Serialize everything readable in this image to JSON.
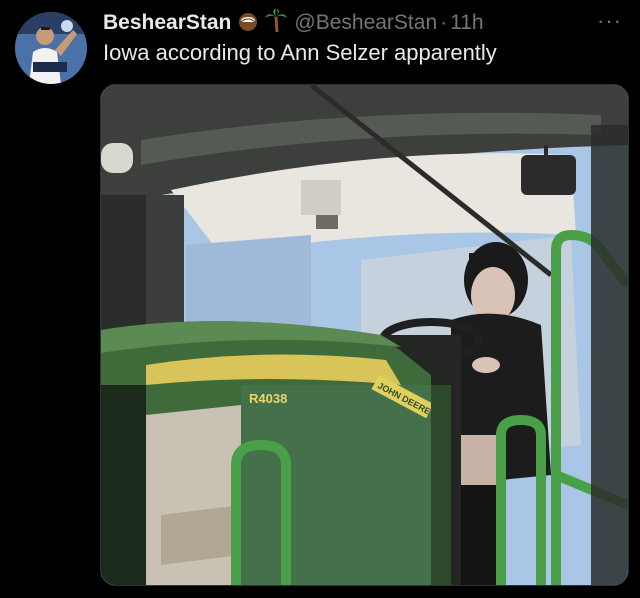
{
  "tweet": {
    "display_name": "BeshearStan",
    "badge_icons": [
      "coconut-emoji",
      "palm-tree-emoji"
    ],
    "handle": "@BeshearStan",
    "separator": "·",
    "time_ago": "11h",
    "text": "Iowa according to Ann Selzer apparently",
    "more_label": "···"
  },
  "media": {
    "model_label": "R4038",
    "brand_label": "JOHN DEERE"
  },
  "colors": {
    "background": "#000000",
    "text_primary": "#e7e9ea",
    "text_secondary": "#71767b",
    "tractor_green": "#3f6a3a",
    "tractor_yellow": "#d9c45a"
  }
}
